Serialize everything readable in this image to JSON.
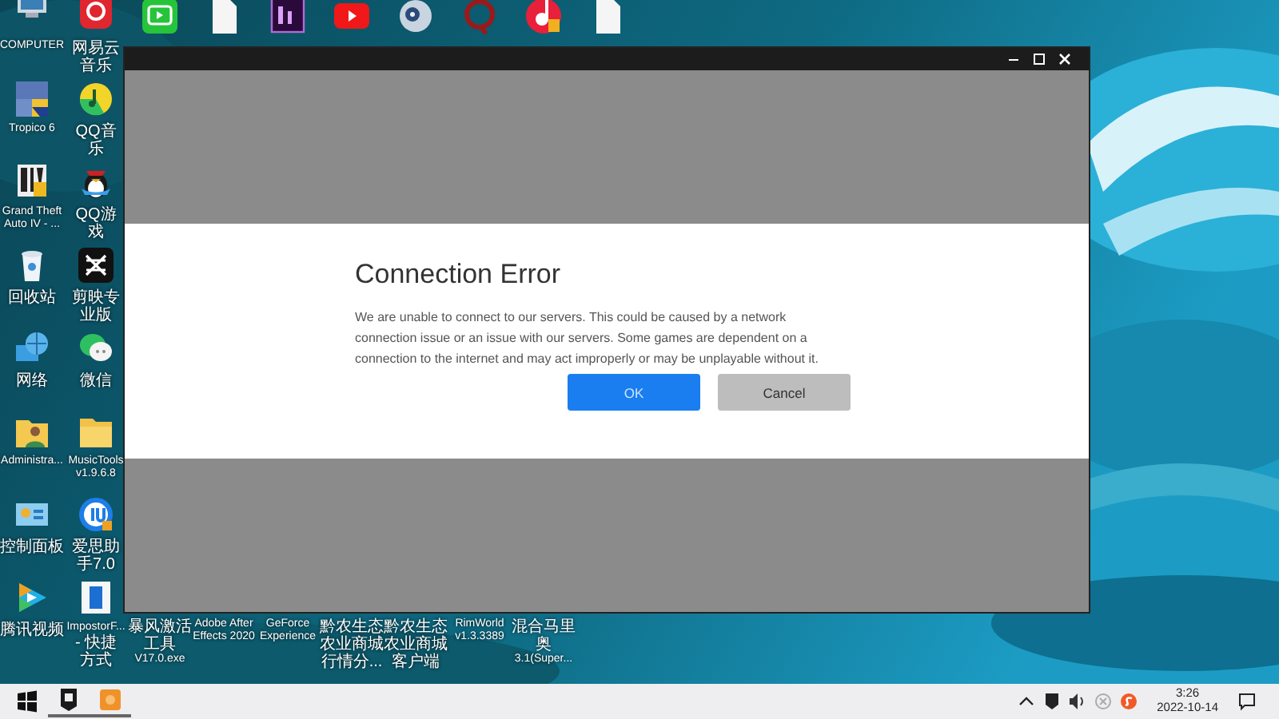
{
  "desktop": {
    "column_1": [
      {
        "label": "COMPUTER"
      },
      {
        "label": "Tropico 6"
      },
      {
        "label": "Grand Theft\nAuto IV - ..."
      },
      {
        "label": "回收站"
      },
      {
        "label": "网络"
      },
      {
        "label": "Administra..."
      },
      {
        "label": "控制面板"
      },
      {
        "label": "腾讯视频"
      }
    ],
    "column_2": [
      {
        "label": "网易云音乐"
      },
      {
        "label": "QQ音乐"
      },
      {
        "label": "QQ游戏"
      },
      {
        "label": "剪映专业版"
      },
      {
        "label": "微信"
      },
      {
        "label": "MusicTools\nv1.9.6.8"
      },
      {
        "label": "爱思助手7.0"
      },
      {
        "label": "ImpostorF...\n- 快捷方式"
      }
    ],
    "bottom_row": [
      {
        "label": "暴风激活工具\nV17.0.exe"
      },
      {
        "label": "Adobe After\nEffects 2020"
      },
      {
        "label": "GeForce\nExperience"
      },
      {
        "label": "黔农生态农业商城行情分..."
      },
      {
        "label": "黔农生态农业商城客户端"
      },
      {
        "label": "RimWorld\nv1.3.3389"
      },
      {
        "label": "混合马里奥\n3.1(Super..."
      }
    ]
  },
  "dialog": {
    "title": "Connection Error",
    "message": "We are unable to connect to our servers. This could be caused by a network connection issue or an issue with our servers. Some games are dependent on a connection to the internet and may act improperly or may be unplayable without it.",
    "buttons": [
      {
        "label": "OK",
        "kind": "primary"
      },
      {
        "label": "Cancel",
        "kind": "secondary"
      }
    ]
  },
  "taskbar": {
    "clock": {
      "time": "3:26",
      "date": "2022-10-14"
    }
  }
}
